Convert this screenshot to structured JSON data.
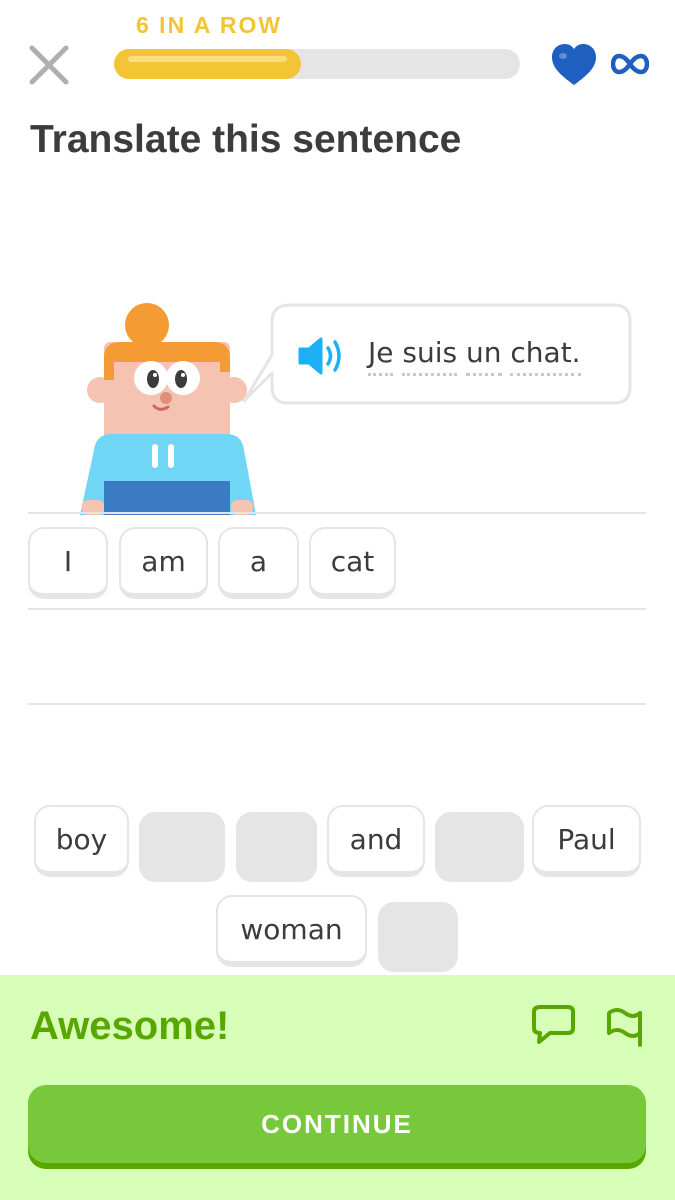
{
  "header": {
    "streak_label": "6 IN A ROW",
    "progress_fraction": 0.46,
    "close_icon": "close-icon",
    "heart_icon": "heart-icon",
    "hearts_icon": "infinity-icon"
  },
  "prompt": {
    "title": "Translate this sentence",
    "speaker_icon": "speaker-icon",
    "sentence_words": [
      "Je",
      "suis",
      "un",
      "chat."
    ]
  },
  "answer": {
    "words": [
      "I",
      "am",
      "a",
      "cat"
    ]
  },
  "word_bank": {
    "row1": [
      "boy",
      "",
      "",
      "and",
      "",
      "Paul"
    ],
    "row2": [
      "woman",
      ""
    ]
  },
  "feedback": {
    "message": "Awesome!",
    "continue_label": "CONTINUE",
    "discuss_icon": "comment-icon",
    "report_icon": "flag-icon"
  },
  "colors": {
    "streak": "#f4c437",
    "success_bg": "#d7ffb8",
    "success_text": "#58a700",
    "continue_button": "#78c83c",
    "heart": "#1e5fbf",
    "speaker": "#1cb0f6"
  }
}
